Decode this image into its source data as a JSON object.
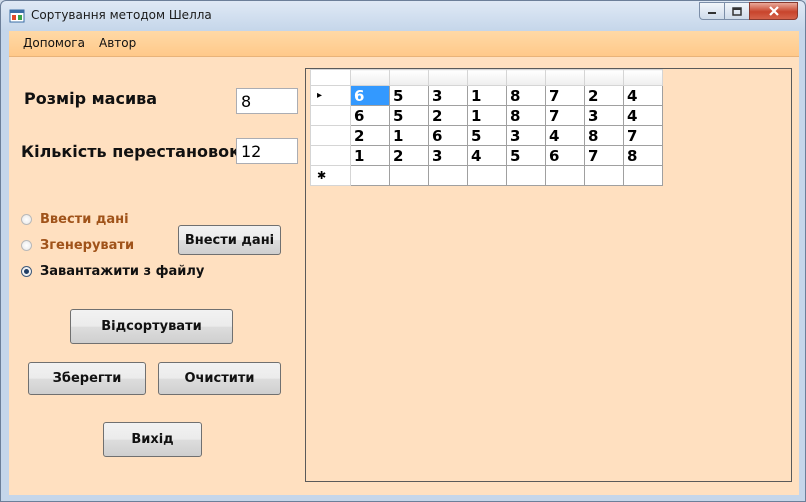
{
  "window": {
    "title": "Сортування методом Шелла",
    "controls": [
      "minimize-icon",
      "maximize-icon",
      "close-icon"
    ]
  },
  "menu": {
    "items": [
      "Допомога",
      "Автор"
    ]
  },
  "form": {
    "array_size_label": "Розмір масива",
    "array_size_value": "8",
    "permutations_label": "Кількість перестановок",
    "permutations_value": "12",
    "radio_options": [
      {
        "label": "Ввести дані",
        "selected": false,
        "color": "#a0531a"
      },
      {
        "label": "Згенерувати",
        "selected": false,
        "color": "#a0531a"
      },
      {
        "label": "Завантажити з файлу",
        "selected": true,
        "color": "#111111"
      }
    ],
    "enter_data_button": "Внести дані",
    "sort_button": "Відсортувати",
    "save_button": "Зберегти",
    "clear_button": "Очистити",
    "exit_button": "Вихід"
  },
  "grid": {
    "current_row_marker": "▸",
    "new_row_marker": "✱",
    "rows": [
      [
        "6",
        "5",
        "3",
        "1",
        "8",
        "7",
        "2",
        "4"
      ],
      [
        "6",
        "5",
        "2",
        "1",
        "8",
        "7",
        "3",
        "4"
      ],
      [
        "2",
        "1",
        "6",
        "5",
        "3",
        "4",
        "8",
        "7"
      ],
      [
        "1",
        "2",
        "3",
        "4",
        "5",
        "6",
        "7",
        "8"
      ]
    ],
    "selected_cell": [
      0,
      0
    ]
  },
  "colors": {
    "client_background": "#ffe0c0",
    "menubar": "#ffc98a",
    "selection": "#3399ff"
  }
}
